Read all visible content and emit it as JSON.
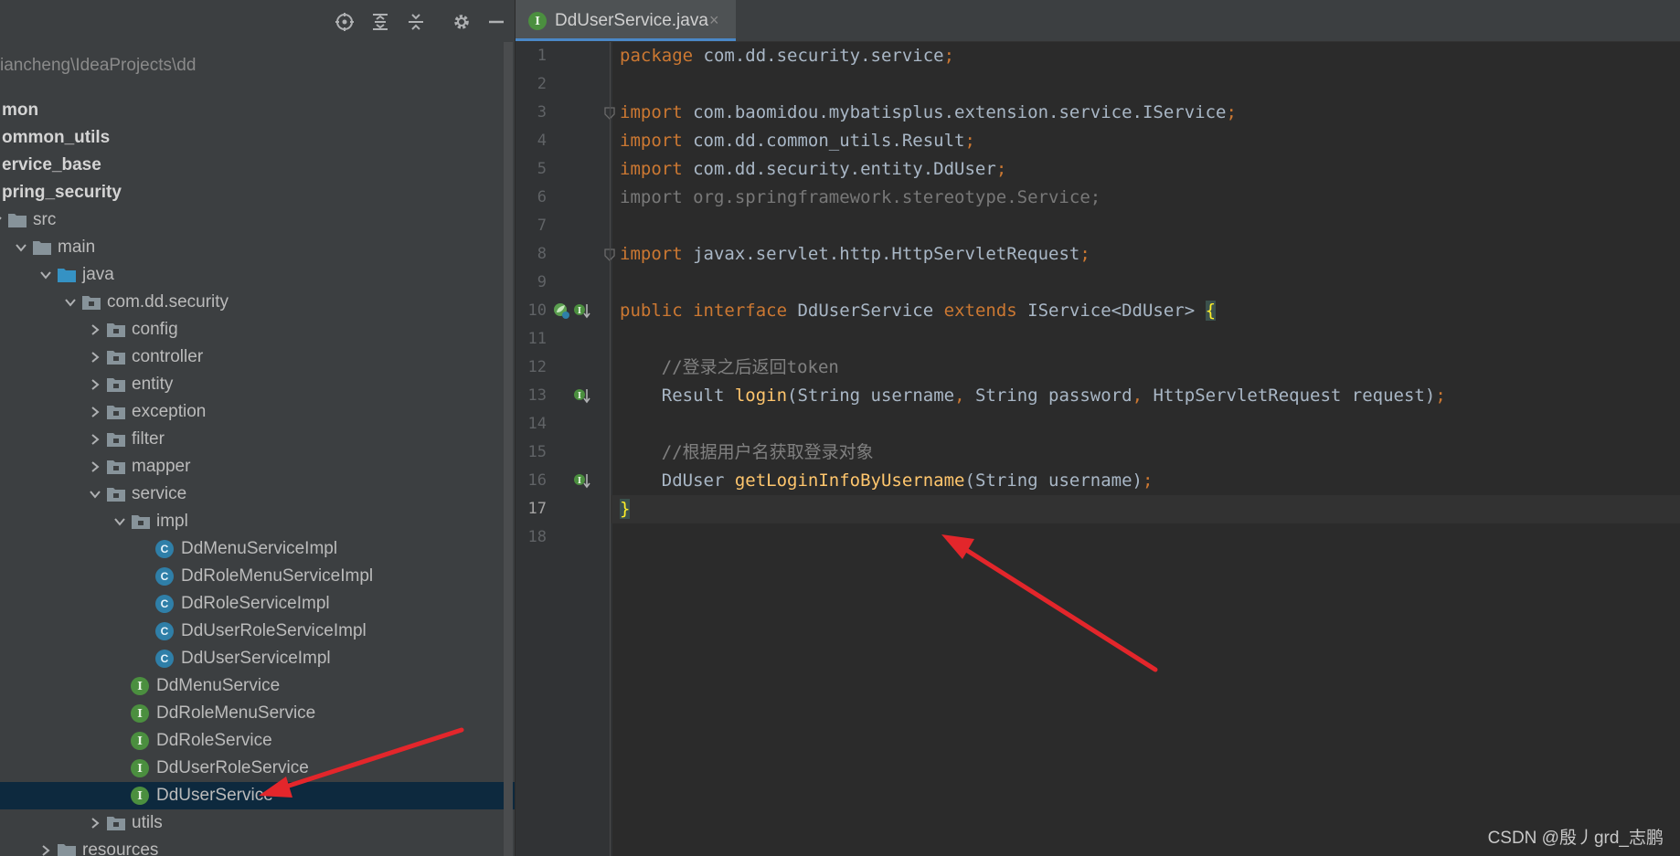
{
  "project": {
    "path": "iancheng\\IdeaProjects\\dd",
    "tree": [
      {
        "label": "mon",
        "indent": 0,
        "bold": true
      },
      {
        "label": "ommon_utils",
        "indent": 0,
        "bold": true
      },
      {
        "label": "ervice_base",
        "indent": 0,
        "bold": true
      },
      {
        "label": "pring_security",
        "indent": 0,
        "bold": true
      },
      {
        "label": "src",
        "indent": 0,
        "icon": "folder",
        "arrow": "down"
      },
      {
        "label": "main",
        "indent": 1,
        "icon": "folder",
        "arrow": "down"
      },
      {
        "label": "java",
        "indent": 2,
        "icon": "folder-source",
        "arrow": "down"
      },
      {
        "label": "com.dd.security",
        "indent": 3,
        "icon": "package",
        "arrow": "down"
      },
      {
        "label": "config",
        "indent": 4,
        "icon": "package",
        "arrow": "right"
      },
      {
        "label": "controller",
        "indent": 4,
        "icon": "package",
        "arrow": "right"
      },
      {
        "label": "entity",
        "indent": 4,
        "icon": "package",
        "arrow": "right"
      },
      {
        "label": "exception",
        "indent": 4,
        "icon": "package",
        "arrow": "right"
      },
      {
        "label": "filter",
        "indent": 4,
        "icon": "package",
        "arrow": "right"
      },
      {
        "label": "mapper",
        "indent": 4,
        "icon": "package",
        "arrow": "right"
      },
      {
        "label": "service",
        "indent": 4,
        "icon": "package",
        "arrow": "down"
      },
      {
        "label": "impl",
        "indent": 5,
        "icon": "package",
        "arrow": "down"
      },
      {
        "label": "DdMenuServiceImpl",
        "indent": 6,
        "icon": "class"
      },
      {
        "label": "DdRoleMenuServiceImpl",
        "indent": 6,
        "icon": "class"
      },
      {
        "label": "DdRoleServiceImpl",
        "indent": 6,
        "icon": "class"
      },
      {
        "label": "DdUserRoleServiceImpl",
        "indent": 6,
        "icon": "class"
      },
      {
        "label": "DdUserServiceImpl",
        "indent": 6,
        "icon": "class"
      },
      {
        "label": "DdMenuService",
        "indent": 5,
        "icon": "interface"
      },
      {
        "label": "DdRoleMenuService",
        "indent": 5,
        "icon": "interface"
      },
      {
        "label": "DdRoleService",
        "indent": 5,
        "icon": "interface"
      },
      {
        "label": "DdUserRoleService",
        "indent": 5,
        "icon": "interface"
      },
      {
        "label": "DdUserService",
        "indent": 5,
        "icon": "interface",
        "selected": true
      },
      {
        "label": "utils",
        "indent": 4,
        "icon": "package",
        "arrow": "right"
      },
      {
        "label": "resources",
        "indent": 2,
        "icon": "folder",
        "arrow": "right"
      }
    ],
    "icon_letters": {
      "class": "C",
      "interface": "I"
    }
  },
  "editor": {
    "tab": {
      "label": "DdUserService.java",
      "close": "×",
      "icon_letter": "I"
    },
    "current_line": 17,
    "lines": [
      [
        {
          "t": "package ",
          "c": "kw"
        },
        {
          "t": "com.dd.security.service"
        },
        {
          "t": ";",
          "c": "kw"
        }
      ],
      [],
      [
        {
          "t": "import ",
          "c": "kw"
        },
        {
          "t": "com.baomidou.mybatisplus.extension.service.IService"
        },
        {
          "t": ";",
          "c": "kw"
        }
      ],
      [
        {
          "t": "import ",
          "c": "kw"
        },
        {
          "t": "com.dd.common_utils.Result"
        },
        {
          "t": ";",
          "c": "kw"
        }
      ],
      [
        {
          "t": "import ",
          "c": "kw"
        },
        {
          "t": "com.dd.security.entity.DdUser"
        },
        {
          "t": ";",
          "c": "kw"
        }
      ],
      [
        {
          "t": "import org.springframework.stereotype.Service;",
          "c": "un"
        }
      ],
      [],
      [
        {
          "t": "import ",
          "c": "kw"
        },
        {
          "t": "javax.servlet.http.HttpServletRequest"
        },
        {
          "t": ";",
          "c": "kw"
        }
      ],
      [],
      [
        {
          "t": "public interface ",
          "c": "kw"
        },
        {
          "t": "DdUserService "
        },
        {
          "t": "extends ",
          "c": "kw"
        },
        {
          "t": "IService<DdUser> "
        },
        {
          "t": "{",
          "c": "br"
        }
      ],
      [],
      [
        {
          "t": "    "
        },
        {
          "t": "//登录之后返回token",
          "c": "cm"
        }
      ],
      [
        {
          "t": "    Result "
        },
        {
          "t": "login",
          "c": "fn"
        },
        {
          "t": "(String username"
        },
        {
          "t": ", ",
          "c": "kw"
        },
        {
          "t": "String password"
        },
        {
          "t": ", ",
          "c": "kw"
        },
        {
          "t": "HttpServletRequest request)"
        },
        {
          "t": ";",
          "c": "kw"
        }
      ],
      [],
      [
        {
          "t": "    "
        },
        {
          "t": "//根据用户名获取登录对象",
          "c": "cm"
        }
      ],
      [
        {
          "t": "    DdUser "
        },
        {
          "t": "getLoginInfoByUsername",
          "c": "fn"
        },
        {
          "t": "(String username)"
        },
        {
          "t": ";",
          "c": "kw"
        }
      ],
      [
        {
          "t": "}",
          "c": "br"
        }
      ],
      []
    ]
  },
  "watermark": "CSDN @殷丿grd_志鹏",
  "colors": {
    "selection": "#0d293e",
    "accent": "#4a88c7",
    "annotation_arrow": "#e3262b"
  }
}
